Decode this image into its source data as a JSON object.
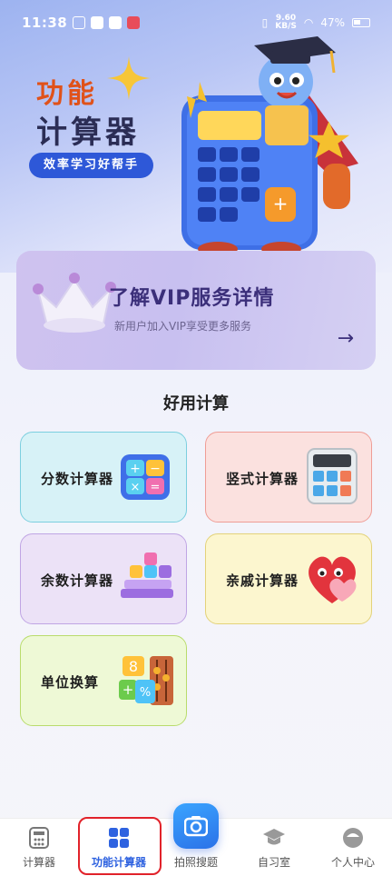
{
  "status_bar": {
    "time": "11:38",
    "net_speed_value": "9.60",
    "net_speed_unit": "KB/S",
    "battery": "47%"
  },
  "hero": {
    "title_line1": "功能",
    "title_line2": "计算器",
    "tagline": "效率学习好帮手"
  },
  "vip": {
    "title": "了解VIP服务详情",
    "subtitle": "新用户加入VIP享受更多服务",
    "arrow": "→"
  },
  "section": {
    "title": "好用计算"
  },
  "tools": [
    {
      "label": "分数计算器"
    },
    {
      "label": "竖式计算器"
    },
    {
      "label": "余数计算器"
    },
    {
      "label": "亲戚计算器"
    },
    {
      "label": "单位换算"
    }
  ],
  "bottom_nav": [
    {
      "label": "计算器",
      "icon": "calculator-icon"
    },
    {
      "label": "功能计算器",
      "icon": "grid-icon",
      "active": true
    },
    {
      "label": "拍照搜题",
      "icon": "camera-icon"
    },
    {
      "label": "自习室",
      "icon": "graduation-cap-icon"
    },
    {
      "label": "个人中心",
      "icon": "user-icon"
    }
  ],
  "colors": {
    "accent": "#2e62e0",
    "title_orange": "#e0521a",
    "highlight": "#e1222a"
  }
}
